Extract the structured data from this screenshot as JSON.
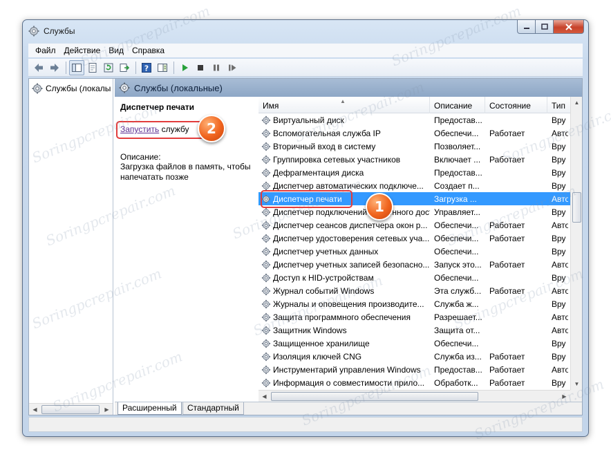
{
  "window": {
    "title": "Службы"
  },
  "menu": [
    "Файл",
    "Действие",
    "Вид",
    "Справка"
  ],
  "tree": {
    "root_label": "Службы (локалы"
  },
  "panel": {
    "header": "Службы (локальные)"
  },
  "description": {
    "service_title": "Диспетчер печати",
    "start_link": "Запустить",
    "start_suffix": " службу",
    "label": "Описание:",
    "text": "Загрузка файлов в память, чтобы напечатать позже"
  },
  "columns": [
    "Имя",
    "Описание",
    "Состояние",
    "Тип"
  ],
  "services": [
    {
      "name": "Виртуальный диск",
      "desc": "Предостав...",
      "status": "",
      "type": "Вру"
    },
    {
      "name": "Вспомогательная служба IP",
      "desc": "Обеспечи...",
      "status": "Работает",
      "type": "Авто"
    },
    {
      "name": "Вторичный вход в систему",
      "desc": "Позволяет...",
      "status": "",
      "type": "Вру"
    },
    {
      "name": "Группировка сетевых участников",
      "desc": "Включает ...",
      "status": "Работает",
      "type": "Вру"
    },
    {
      "name": "Дефрагментация диска",
      "desc": "Предостав...",
      "status": "",
      "type": "Вру"
    },
    {
      "name": "Диспетчер автоматических подключе...",
      "desc": "Создает п...",
      "status": "",
      "type": "Вру"
    },
    {
      "name": "Диспетчер печати",
      "desc": "Загрузка ...",
      "status": "",
      "type": "Авто",
      "selected": true
    },
    {
      "name": "Диспетчер подключений удаленного доступа",
      "desc": "Управляет...",
      "status": "",
      "type": "Вру"
    },
    {
      "name": "Диспетчер сеансов диспетчера окон р...",
      "desc": "Обеспечи...",
      "status": "Работает",
      "type": "Авто"
    },
    {
      "name": "Диспетчер удостоверения сетевых уча...",
      "desc": "Обеспечи...",
      "status": "Работает",
      "type": "Вру"
    },
    {
      "name": "Диспетчер учетных данных",
      "desc": "Обеспечи...",
      "status": "",
      "type": "Вру"
    },
    {
      "name": "Диспетчер учетных записей безопасно...",
      "desc": "Запуск это...",
      "status": "Работает",
      "type": "Авто"
    },
    {
      "name": "Доступ к HID-устройствам",
      "desc": "Обеспечи...",
      "status": "",
      "type": "Вру"
    },
    {
      "name": "Журнал событий Windows",
      "desc": "Эта служб...",
      "status": "Работает",
      "type": "Авто"
    },
    {
      "name": "Журналы и оповещения производите...",
      "desc": "Служба ж...",
      "status": "",
      "type": "Вру"
    },
    {
      "name": "Защита программного обеспечения",
      "desc": "Разрешает...",
      "status": "",
      "type": "Авто"
    },
    {
      "name": "Защитник Windows",
      "desc": "Защита от...",
      "status": "",
      "type": "Авто"
    },
    {
      "name": "Защищенное хранилище",
      "desc": "Обеспечи...",
      "status": "",
      "type": "Вру"
    },
    {
      "name": "Изоляция ключей CNG",
      "desc": "Служба из...",
      "status": "Работает",
      "type": "Вру"
    },
    {
      "name": "Инструментарий управления Windows",
      "desc": "Предостав...",
      "status": "Работает",
      "type": "Авто"
    },
    {
      "name": "Информация о совместимости прило...",
      "desc": "Обработк...",
      "status": "Работает",
      "type": "Вру"
    }
  ],
  "tabs": [
    "Расширенный",
    "Стандартный"
  ],
  "callouts": [
    "1",
    "2"
  ],
  "watermark": "Soringpcrepair.com",
  "accent_colors": {
    "selection": "#3399ff",
    "highlight_border": "#e23c3c",
    "badge": "#f0641e"
  }
}
